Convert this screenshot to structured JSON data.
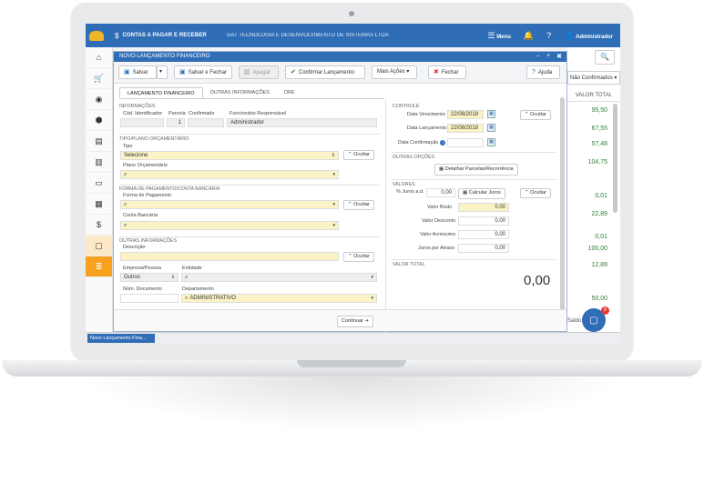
{
  "topbar": {
    "module": "CONTAS A PAGAR E RECEBER",
    "company": "GAT TECNOLOGIA E DESENVOLVIMENTO DE SISTEMAS LTDA",
    "menu": "Menu",
    "user": "Administrador"
  },
  "sidebar": {
    "icons": [
      "home-icon",
      "cart-icon",
      "eye-icon",
      "box-icon",
      "register-icon",
      "building-icon",
      "card-icon",
      "chart-icon",
      "dollar-icon",
      "folder-icon",
      "list-icon"
    ]
  },
  "modal": {
    "title": "NOVO LANÇAMENTO FINANCEIRO",
    "controls": {
      "minimize": "–",
      "add": "+",
      "close": "✖"
    },
    "toolbar": {
      "save": "Salvar",
      "save_close": "Salvar e Fechar",
      "delete": "Apagar",
      "confirm": "Confirmar Lançamento",
      "more": "Mais Ações",
      "close": "Fechar",
      "help": "Ajuda"
    },
    "tabs": [
      "LANÇAMENTO FINANCEIRO",
      "OUTRAS INFORMAÇÕES",
      "DRE"
    ],
    "info": {
      "section": "INFORMAÇÕES",
      "cod_label": "Cód. Identificador",
      "parcela_label": "Parcela",
      "confirmado_label": "Confirmado",
      "funcionario_label": "Funcionário Responsável",
      "parcela_value": "1",
      "funcionario_value": "Administrador"
    },
    "tipo": {
      "section": "TIPO/PLANO ORÇAMENTÁRIO",
      "tipo_label": "Tipo",
      "tipo_value": "Selecione",
      "plano_label": "Plano Orçamentário",
      "hide": "Ocultar"
    },
    "pagamento": {
      "section": "FORMA DE PAGAMENTO/CONTA BANCÁRIA",
      "forma_label": "Forma de Pagamento",
      "conta_label": "Conta Bancária",
      "hide": "Ocultar"
    },
    "outras": {
      "section": "OUTRAS INFORMAÇÕES",
      "descricao_label": "Descrição",
      "hide": "Ocultar",
      "empresa_label": "Empresa/Pessoa",
      "empresa_value": "Outros",
      "entidade_label": "Entidade",
      "num_doc_label": "Núm. Documento",
      "departamento_label": "Departamento",
      "departamento_value": "ADMINISTRATIVO"
    },
    "controle": {
      "section": "CONTROLE",
      "vencimento_label": "Data Vencimento",
      "vencimento_value": "22/08/2018",
      "lancamento_label": "Data Lançamento",
      "lancamento_value": "22/08/2018",
      "confirmacao_label": "Data Confirmação",
      "hide": "Ocultar"
    },
    "opcoes": {
      "section": "OUTRAS OPÇÕES",
      "parcelas_button": "Detalhar Parcelas/Recorrência"
    },
    "valores": {
      "section": "VALORES",
      "juros_ad_label": "% Juros a.d.",
      "juros_ad_value": "0,00",
      "calc_button": "Calcular Juros",
      "hide": "Ocultar",
      "bruto_label": "Valor Bruto",
      "bruto_value": "0,00",
      "desconto_label": "Valor Desconto",
      "desconto_value": "0,00",
      "acrescimo_label": "Valor Acréscimo",
      "acrescimo_value": "0,00",
      "atraso_label": "Juros por Atraso",
      "atraso_value": "0,00"
    },
    "total": {
      "section": "VALOR TOTAL",
      "value": "0,00"
    },
    "continue": "Continuar"
  },
  "right_panel": {
    "filter": "Não Confirmados",
    "header": "VALOR TOTAL",
    "values": [
      "95,50",
      "67,55",
      "57,48",
      "104,75",
      "0,01",
      "22,89",
      "0,01",
      "100,00",
      "12,89",
      "50,00"
    ],
    "saldo_label": "Saldo:"
  },
  "chat": {
    "badge": "8"
  },
  "taskbar": {
    "item": "Novo Lançamento Fina..."
  }
}
